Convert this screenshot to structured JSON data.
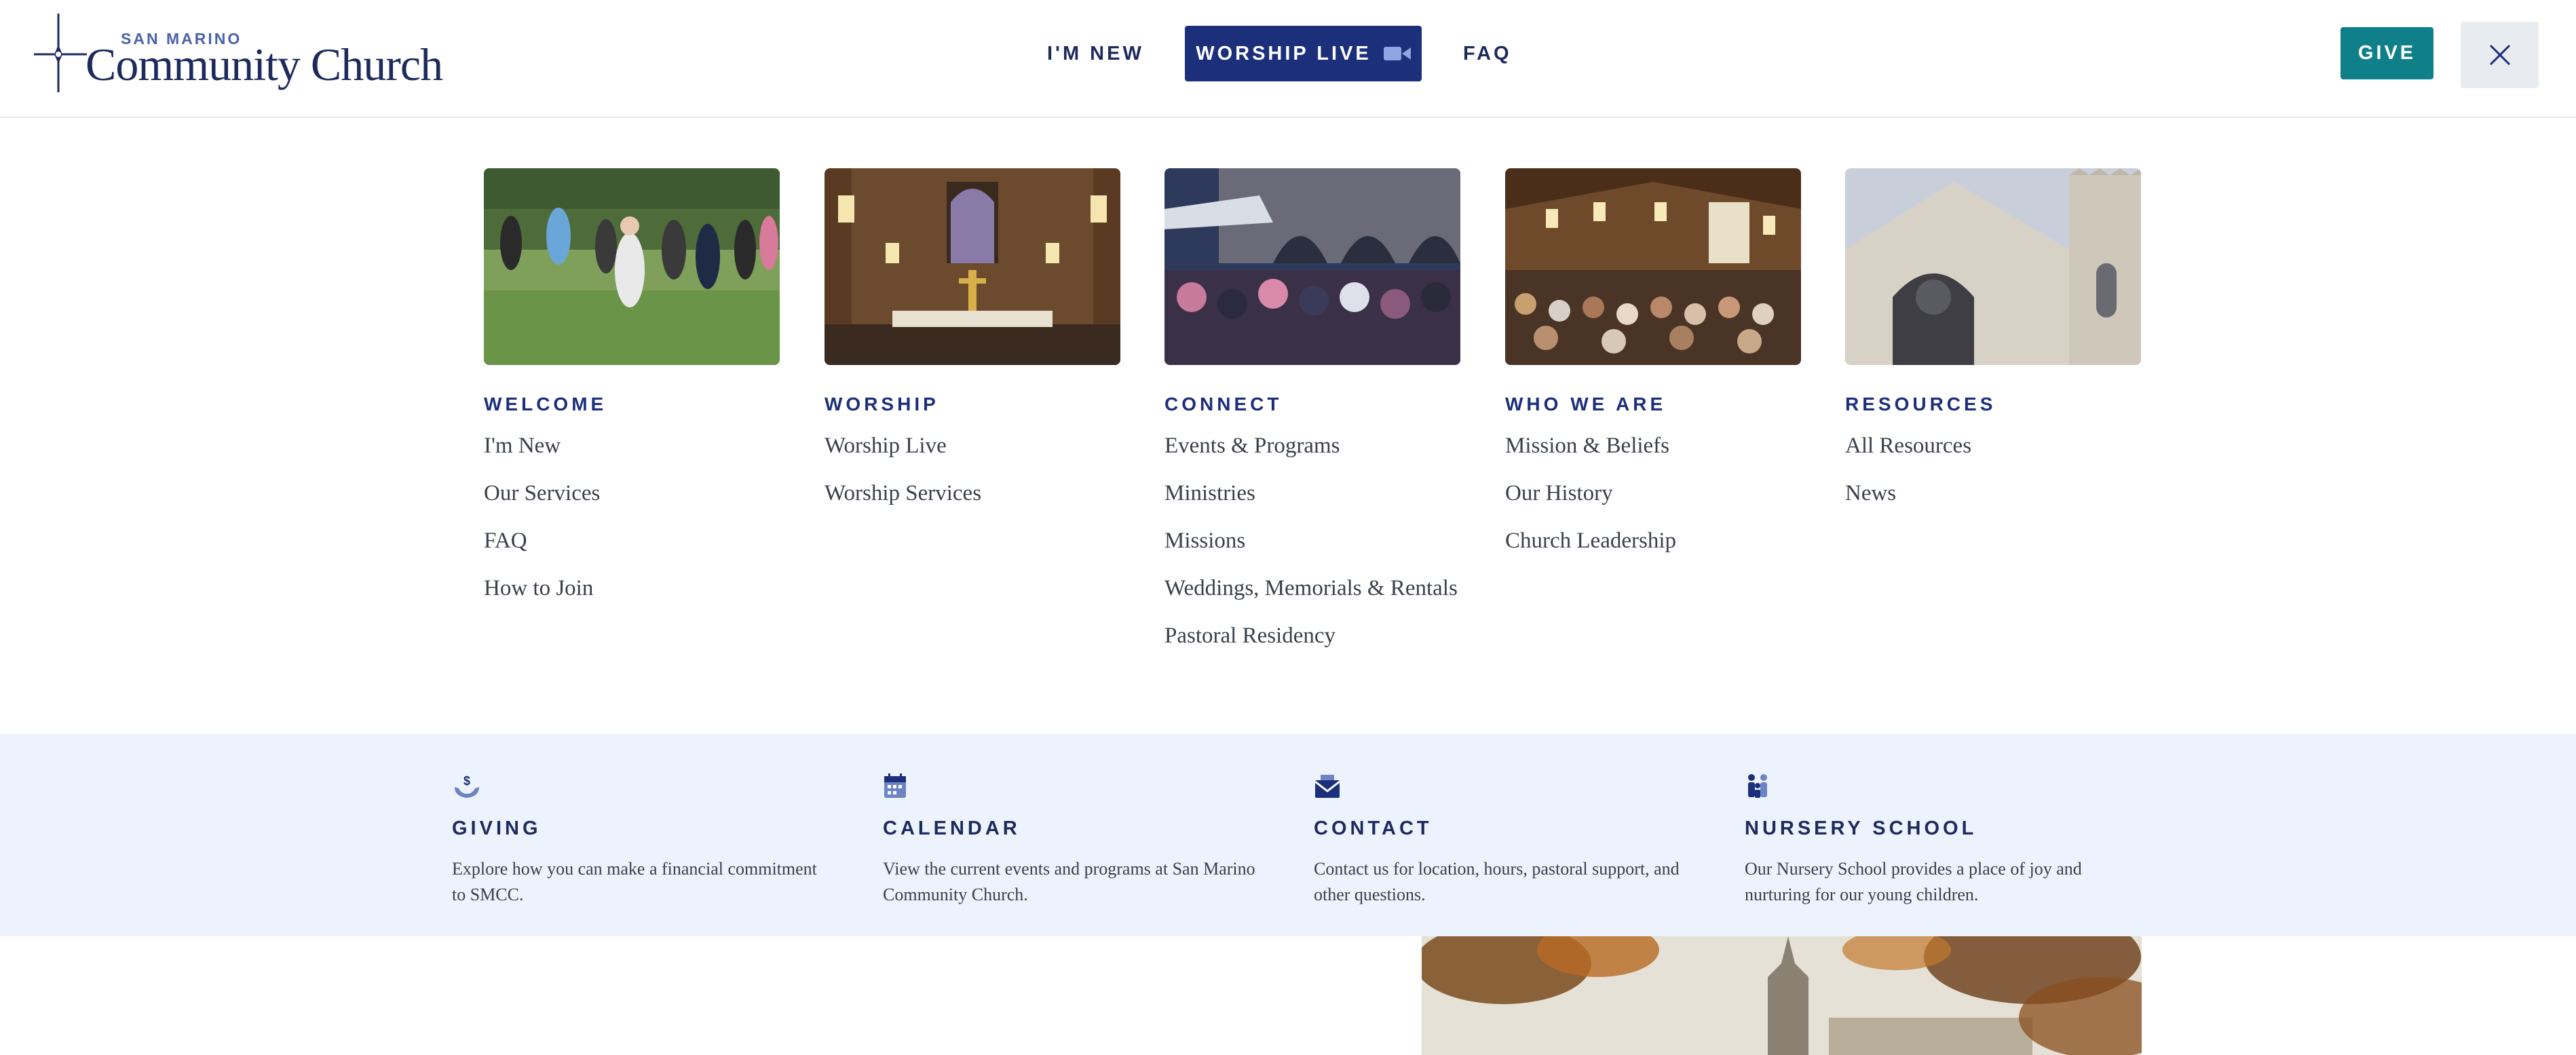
{
  "header": {
    "logo_small": "SAN MARINO",
    "logo_main": "Community Church",
    "nav": {
      "new_label": "I'M NEW",
      "live_label": "WORSHIP LIVE",
      "faq_label": "FAQ"
    },
    "give_label": "GIVE",
    "colors": {
      "brand_navy": "#1c2f7a",
      "give_teal": "#0f7f8a"
    }
  },
  "menu": {
    "columns": [
      {
        "title": "WELCOME",
        "image": "congregation-waving-photo",
        "links": [
          "I'm New",
          "Our Services",
          "FAQ",
          "How to Join"
        ]
      },
      {
        "title": "WORSHIP",
        "image": "sanctuary-altar-photo",
        "links": [
          "Worship Live",
          "Worship Services"
        ]
      },
      {
        "title": "CONNECT",
        "image": "courtyard-crowd-photo",
        "links": [
          "Events & Programs",
          "Ministries",
          "Missions",
          "Weddings, Memorials & Rentals",
          "Pastoral Residency"
        ]
      },
      {
        "title": "WHO WE ARE",
        "image": "sanctuary-congregation-photo",
        "links": [
          "Mission & Beliefs",
          "Our History",
          "Church Leadership"
        ]
      },
      {
        "title": "RESOURCES",
        "image": "church-facade-photo",
        "links": [
          "All Resources",
          "News"
        ]
      }
    ]
  },
  "quick_links": [
    {
      "icon": "giving-hands-icon",
      "title": "GIVING",
      "description": "Explore how you can make a financial commitment to SMCC."
    },
    {
      "icon": "calendar-icon",
      "title": "CALENDAR",
      "description": "View the current events and programs at San Marino Community Church."
    },
    {
      "icon": "envelope-icon",
      "title": "CONTACT",
      "description": "Contact us for location, hours, pastoral support, and other questions."
    },
    {
      "icon": "family-icon",
      "title": "NURSERY SCHOOL",
      "description": "Our Nursery School provides a place of joy and nurturing for our young children."
    }
  ]
}
